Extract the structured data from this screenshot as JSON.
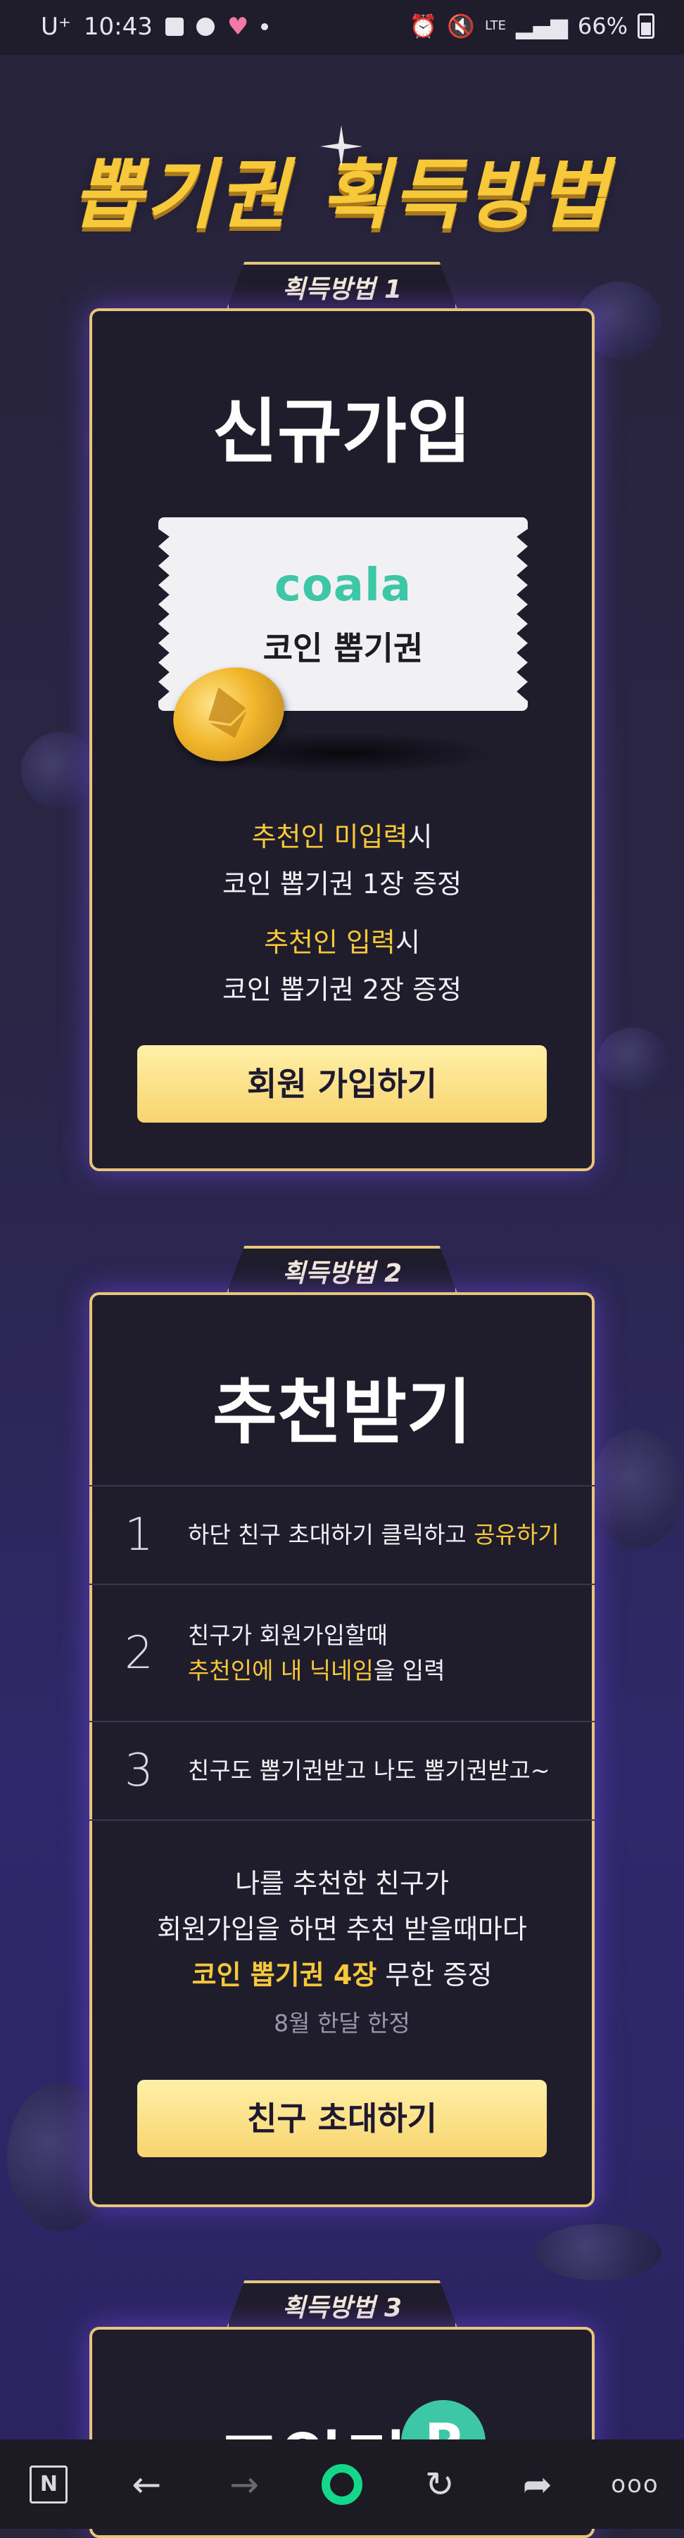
{
  "status_bar": {
    "carrier": "U⁺",
    "time": "10:43",
    "battery": "66%",
    "network": "LTE"
  },
  "page_title": "뽑기권 획득방법",
  "method1": {
    "tab": "획득방법 1",
    "title": "신규가입",
    "ticket_logo": "coala",
    "ticket_text": "코인 뽑기권",
    "line1_hl": "추천인 미입력",
    "line1_suffix": "시",
    "line2": "코인 뽑기권 1장 증정",
    "line3_hl": "추천인 입력",
    "line3_suffix": "시",
    "line4": "코인 뽑기권 2장 증정",
    "button": "회원 가입하기"
  },
  "method2": {
    "tab": "획득방법 2",
    "title": "추천받기",
    "steps": [
      {
        "num": "1",
        "text_a": "하단 친구 초대하기 클릭하고 ",
        "text_hl": "공유하기"
      },
      {
        "num": "2",
        "text_a": "친구가 회원가입할때",
        "text_hl": "추천인에 내 닉네임",
        "text_b": "을 입력"
      },
      {
        "num": "3",
        "text_a": "친구도 뽑기권받고 나도 뽑기권받고~"
      }
    ],
    "desc1": "나를 추천한 친구가",
    "desc2": "회원가입을 하면 추천 받을때마다",
    "desc3_hl": "코인 뽑기권 4장",
    "desc3_suffix": " 무한 증정",
    "note": "8월 한달 한정",
    "button": "친구 초대하기"
  },
  "method3": {
    "tab": "획득방법 3",
    "title_partial": "코알라",
    "badge": "P"
  },
  "bottom_nav": {
    "n_label": "N",
    "more": "ooo"
  },
  "colors": {
    "accent_yellow": "#f7c83a",
    "card_border": "#e7c57a",
    "brand_green": "#3ec7a6"
  }
}
